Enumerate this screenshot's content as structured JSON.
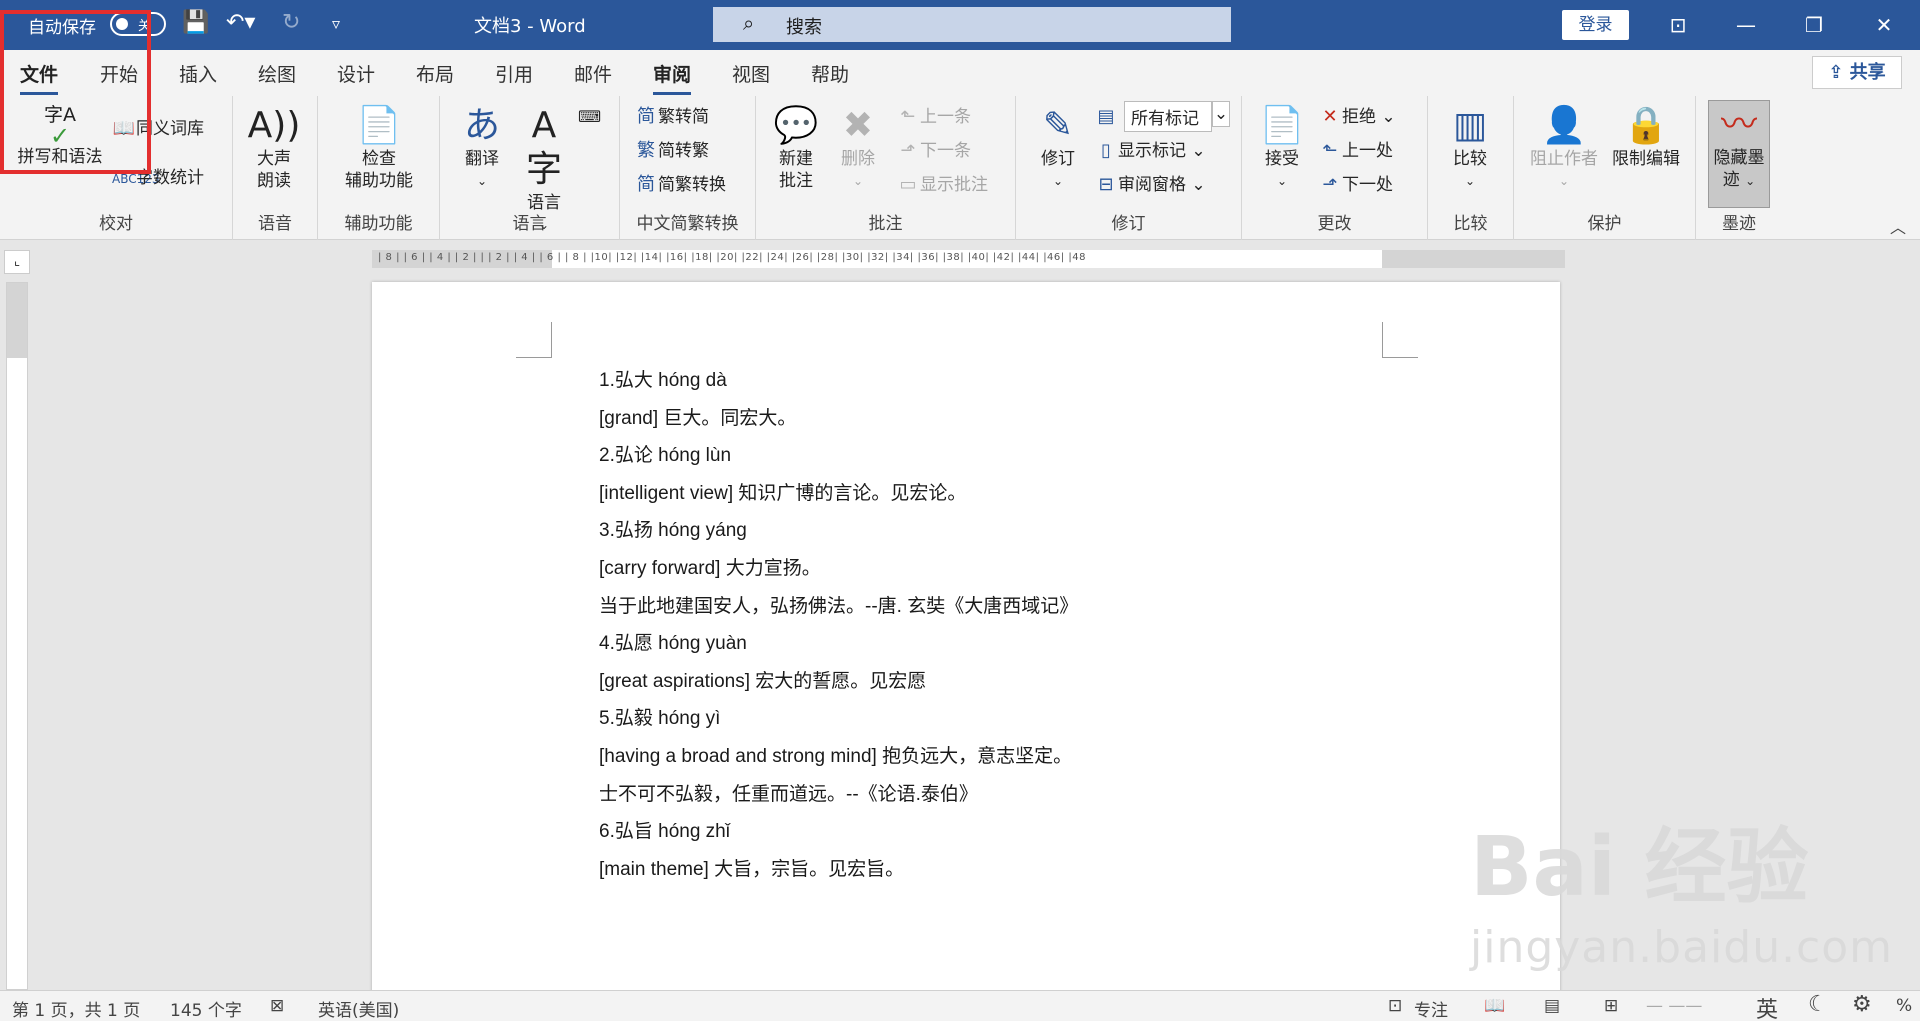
{
  "titlebar": {
    "autosave_label": "自动保存",
    "toggle_state": "关",
    "doc_title": "文档3  -  Word",
    "search_placeholder": "搜索",
    "login_label": "登录"
  },
  "tabs": [
    "文件",
    "开始",
    "插入",
    "绘图",
    "设计",
    "布局",
    "引用",
    "邮件",
    "审阅",
    "视图",
    "帮助"
  ],
  "active_tab": "审阅",
  "share_label": "共享",
  "ribbon": {
    "proofing": {
      "label": "校对",
      "spell": "拼写和语法",
      "thesaurus": "同义词库",
      "wordcount": "字数统计",
      "spell_icon_text": "字A"
    },
    "speech": {
      "label": "语音",
      "read_aloud_1": "大声",
      "read_aloud_2": "朗读"
    },
    "accessibility": {
      "label": "辅助功能",
      "check_1": "检查",
      "check_2": "辅助功能"
    },
    "language": {
      "label": "语言",
      "translate": "翻译",
      "language": "语言"
    },
    "chinese": {
      "label": "中文简繁转换",
      "t2s": "繁转简",
      "s2t": "简转繁",
      "convert": "简繁转换"
    },
    "comments": {
      "label": "批注",
      "new_1": "新建",
      "new_2": "批注",
      "delete": "删除",
      "prev": "上一条",
      "next": "下一条",
      "show": "显示批注"
    },
    "tracking": {
      "label": "修订",
      "track": "修订",
      "markup_select": "所有标记",
      "show_markup": "显示标记",
      "review_pane": "审阅窗格"
    },
    "changes": {
      "label": "更改",
      "accept": "接受",
      "reject": "拒绝",
      "prev": "上一处",
      "next": "下一处"
    },
    "compare": {
      "label": "比较",
      "compare": "比较"
    },
    "protect": {
      "label": "保护",
      "block_authors": "阻止作者",
      "restrict": "限制编辑"
    },
    "ink": {
      "label": "墨迹",
      "hide_1": "隐藏墨",
      "hide_2": "迹"
    }
  },
  "document": {
    "lines": [
      "1.弘大  hóng dà",
      "[grand]  巨大。同宏大。",
      "2.弘论  hóng lùn",
      "[intelligent view]  知识广博的言论。见宏论。",
      "3.弘扬  hóng yáng",
      "[carry forward]  大力宣扬。",
      "当于此地建国安人，弘扬佛法。--唐. 玄奘《大唐西域记》",
      "4.弘愿  hóng yuàn",
      "[great aspirations]  宏大的誓愿。见宏愿",
      "5.弘毅  hóng yì",
      "[having a broad and strong mind]  抱负远大，意志坚定。",
      "士不可不弘毅，任重而道远。--《论语.泰伯》",
      "6.弘旨  hóng zhǐ",
      "[main theme]  大旨，宗旨。见宏旨。"
    ]
  },
  "ruler": {
    "h_labels": "| 8 |   | 6 |   | 4 |   | 2 |   |   | 2 |   | 4 |   | 6 |   | 8 |   |10|   |12|   |14|   |16|   |18|   |20|   |22|   |24|   |26|   |28|   |30|   |32|   |34|   |36|   |38|   |40|   |42|   |44|   |46|   |48"
  },
  "statusbar": {
    "page": "第 1 页，共 1 页",
    "words": "145 个字",
    "lang": "英语(美国)",
    "focus": "专注",
    "ime": "英",
    "zoom": "%"
  },
  "watermark": {
    "brand": "Bai  经验",
    "url": "jingyan.baidu.com"
  }
}
